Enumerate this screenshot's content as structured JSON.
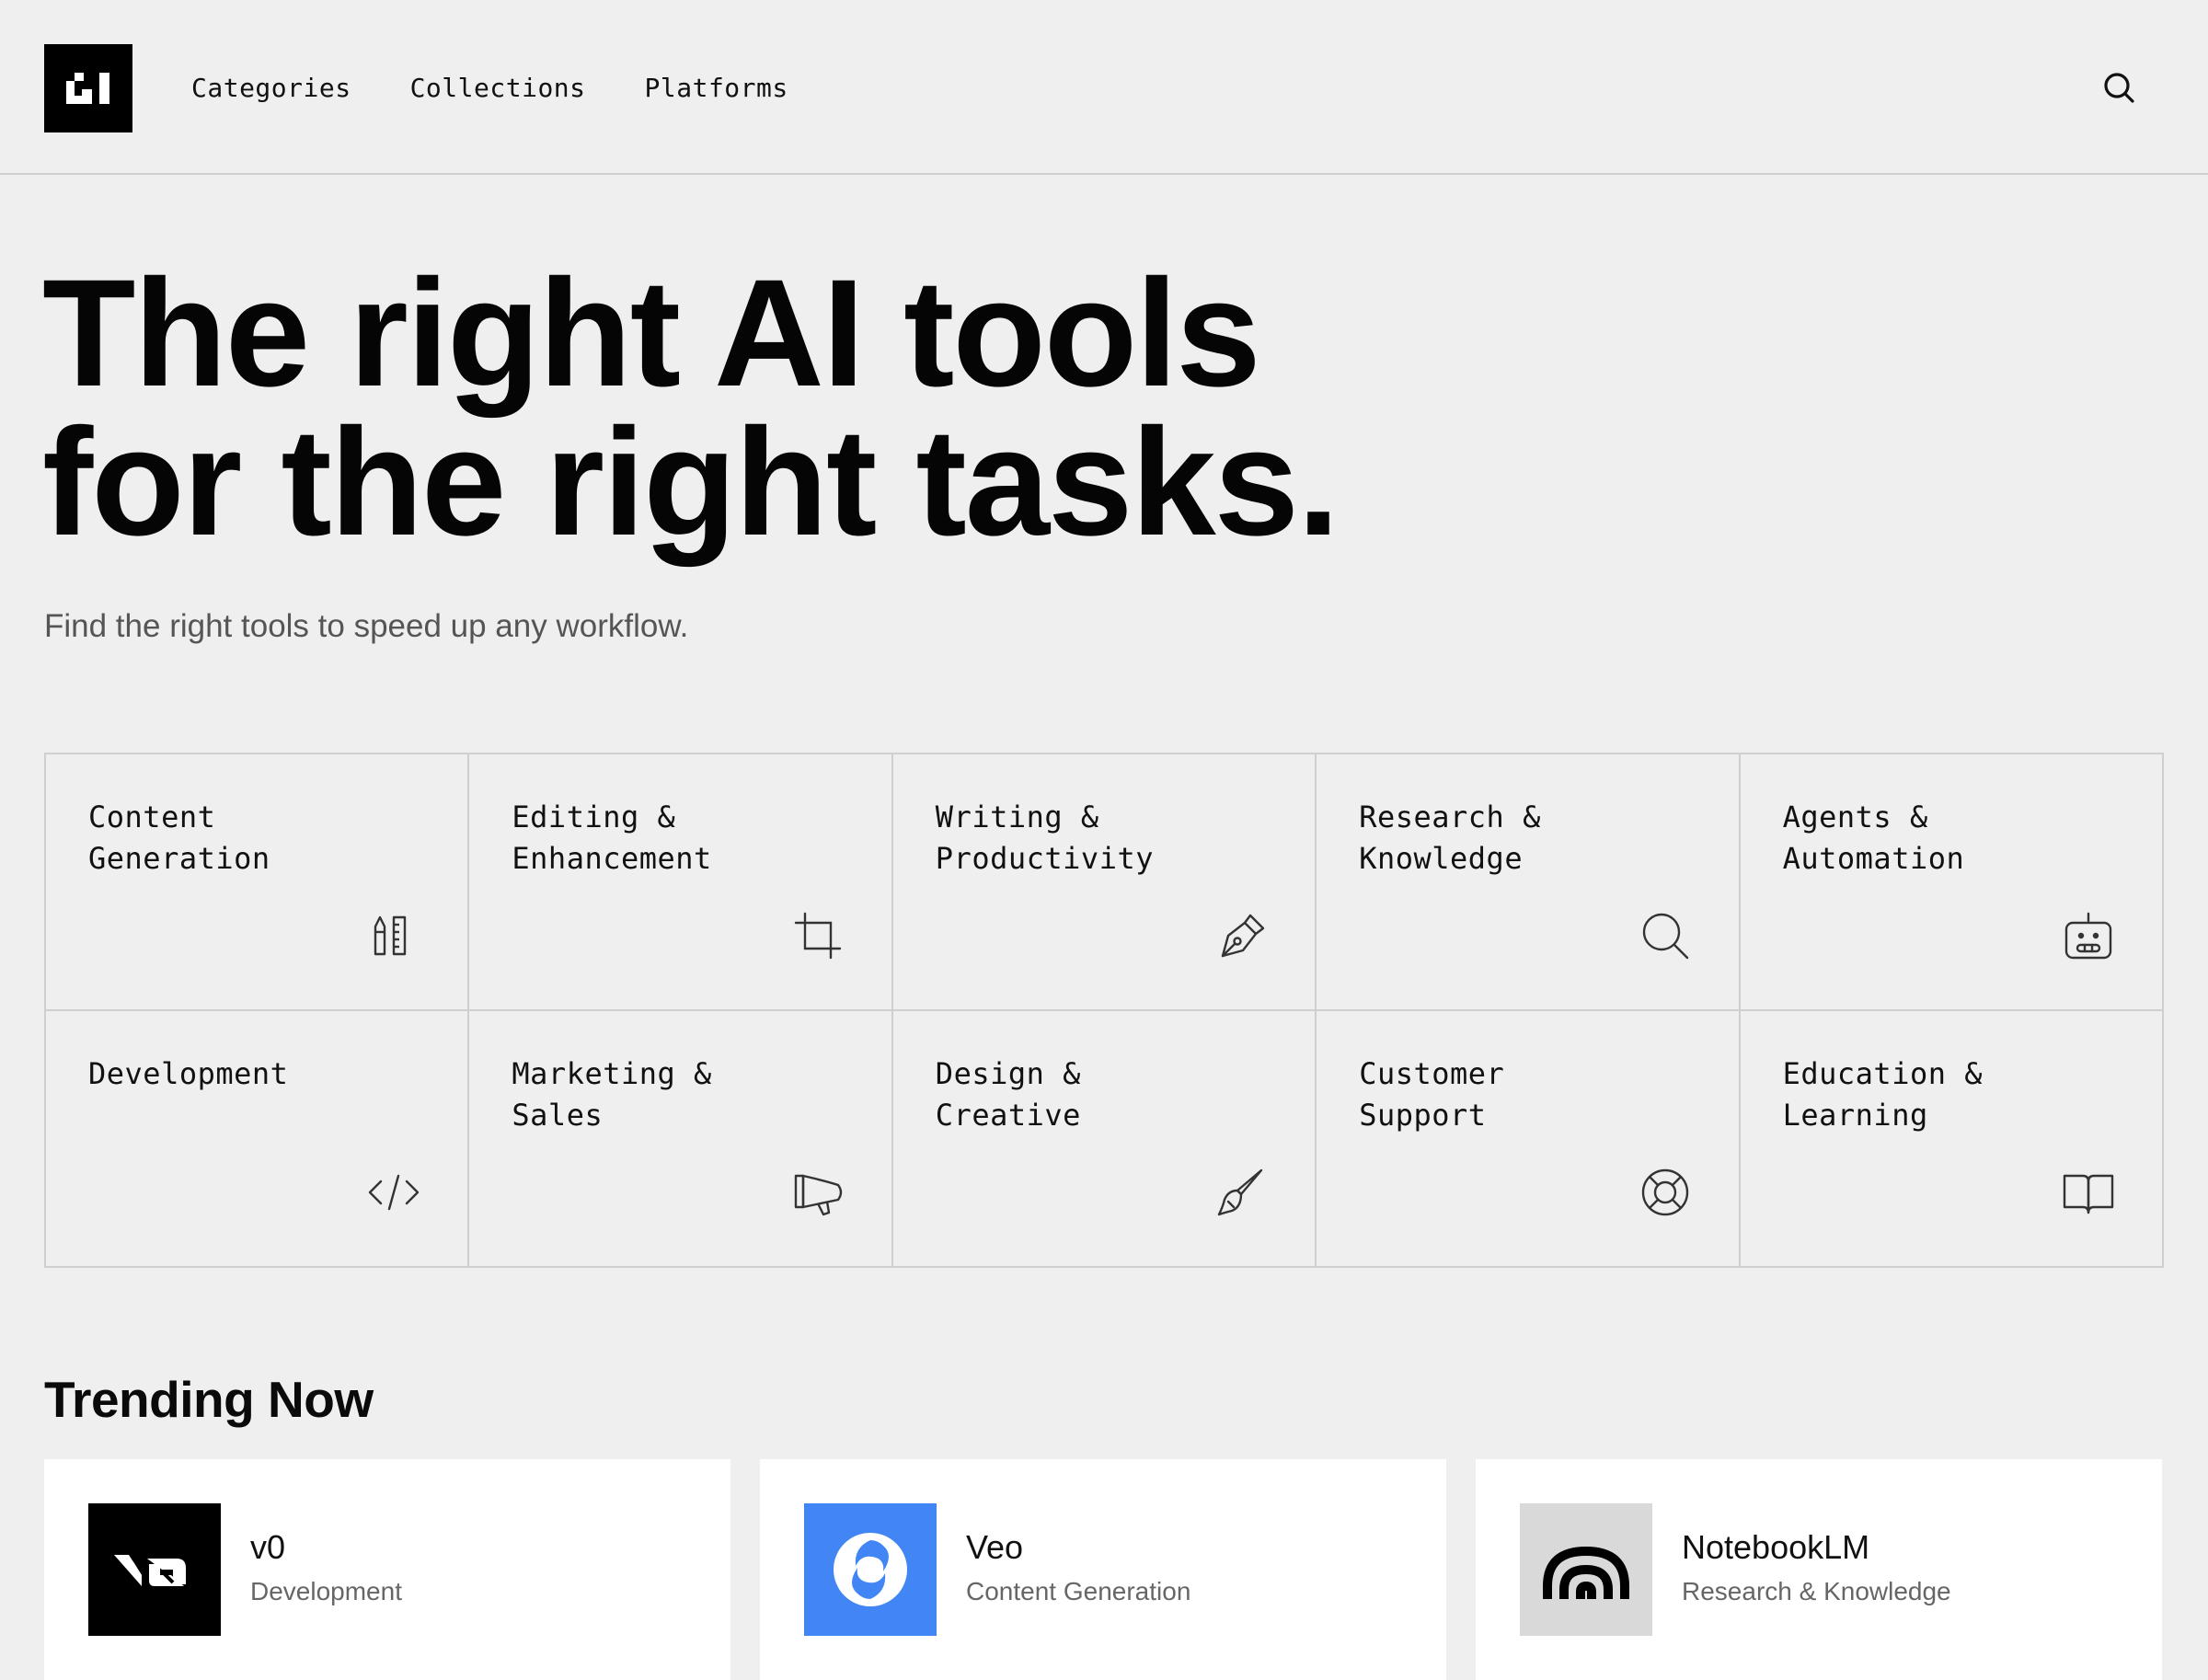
{
  "header": {
    "logo_icon": "brand-logo-icon",
    "nav": [
      {
        "label": "Categories"
      },
      {
        "label": "Collections"
      },
      {
        "label": "Platforms"
      }
    ],
    "search_icon": "search-icon"
  },
  "hero": {
    "title_line1": "The right AI tools",
    "title_line2": "for the right tasks.",
    "subtitle": "Find the right tools to speed up any workflow."
  },
  "categories": [
    {
      "label": "Content\nGeneration",
      "icon": "pencil-ruler-icon"
    },
    {
      "label": "Editing &\nEnhancement",
      "icon": "crop-icon"
    },
    {
      "label": "Writing &\nProductivity",
      "icon": "pen-nib-icon"
    },
    {
      "label": "Research &\nKnowledge",
      "icon": "magnifier-icon"
    },
    {
      "label": "Agents &\nAutomation",
      "icon": "robot-icon"
    },
    {
      "label": "Development",
      "icon": "code-icon"
    },
    {
      "label": "Marketing &\nSales",
      "icon": "megaphone-icon"
    },
    {
      "label": "Design &\nCreative",
      "icon": "paintbrush-icon"
    },
    {
      "label": "Customer\nSupport",
      "icon": "lifebuoy-icon"
    },
    {
      "label": "Education &\nLearning",
      "icon": "open-book-icon"
    }
  ],
  "trending": {
    "title": "Trending Now",
    "items": [
      {
        "name": "v0",
        "category": "Development",
        "icon": "v0-logo-icon",
        "color": "#000000"
      },
      {
        "name": "Veo",
        "category": "Content Generation",
        "icon": "veo-logo-icon",
        "color": "#4285f4"
      },
      {
        "name": "NotebookLM",
        "category": "Research & Knowledge",
        "icon": "notebooklm-logo-icon",
        "color": "#d9d9d9"
      }
    ]
  },
  "colors": {
    "background": "#efefef",
    "grid_line": "#cfcfcf",
    "text": "#0a0a0a",
    "muted": "#555555"
  }
}
